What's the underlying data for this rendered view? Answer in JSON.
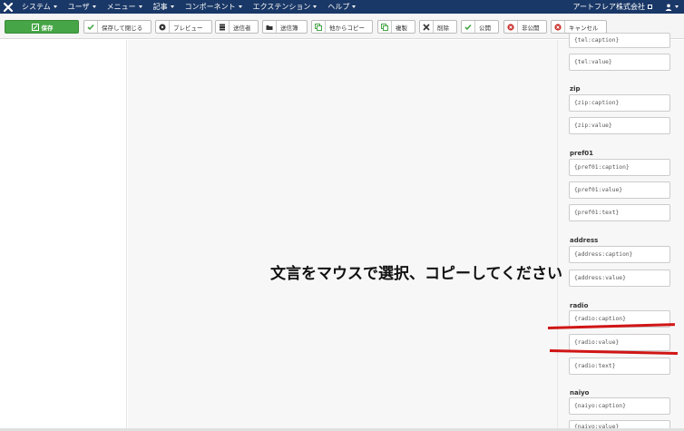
{
  "navbar": {
    "menu": [
      "システム",
      "ユーザ",
      "メニュー",
      "記事",
      "コンポーネント",
      "エクステンション",
      "ヘルプ"
    ],
    "site_name": "アートフレア株式会社",
    "accent": "#1a3867"
  },
  "toolbar": {
    "save": "保存",
    "save_close": "保存して閉じる",
    "preview": "プレビュー",
    "sender": "送信者",
    "sent_box": "送信簿",
    "copy_from": "他からコピー",
    "duplicate": "複製",
    "delete": "削除",
    "publish": "公開",
    "unpublish": "非公開",
    "cancel": "キャンセル"
  },
  "overlay_text": "文言をマウスで選択、コピーしてください",
  "tags": {
    "tel_caption_partial": "{tel:caption}",
    "tel_value": "{tel:value}",
    "zip_label": "zip",
    "zip_caption": "{zip:caption}",
    "zip_value": "{zip:value}",
    "pref01_label": "pref01",
    "pref01_caption": "{pref01:caption}",
    "pref01_value": "{pref01:value}",
    "pref01_text": "{pref01:text}",
    "address_label": "address",
    "address_caption": "{address:caption}",
    "address_value": "{address:value}",
    "radio_label": "radio",
    "radio_caption": "{radio:caption}",
    "radio_value": "{radio:value}",
    "radio_text": "{radio:text}",
    "naiyo_label": "naiyo",
    "naiyo_caption": "{naiyo:caption}",
    "naiyo_value": "{naiyo:value}"
  },
  "colors": {
    "save_green": "#46a546",
    "annotation_red": "#d01515"
  }
}
